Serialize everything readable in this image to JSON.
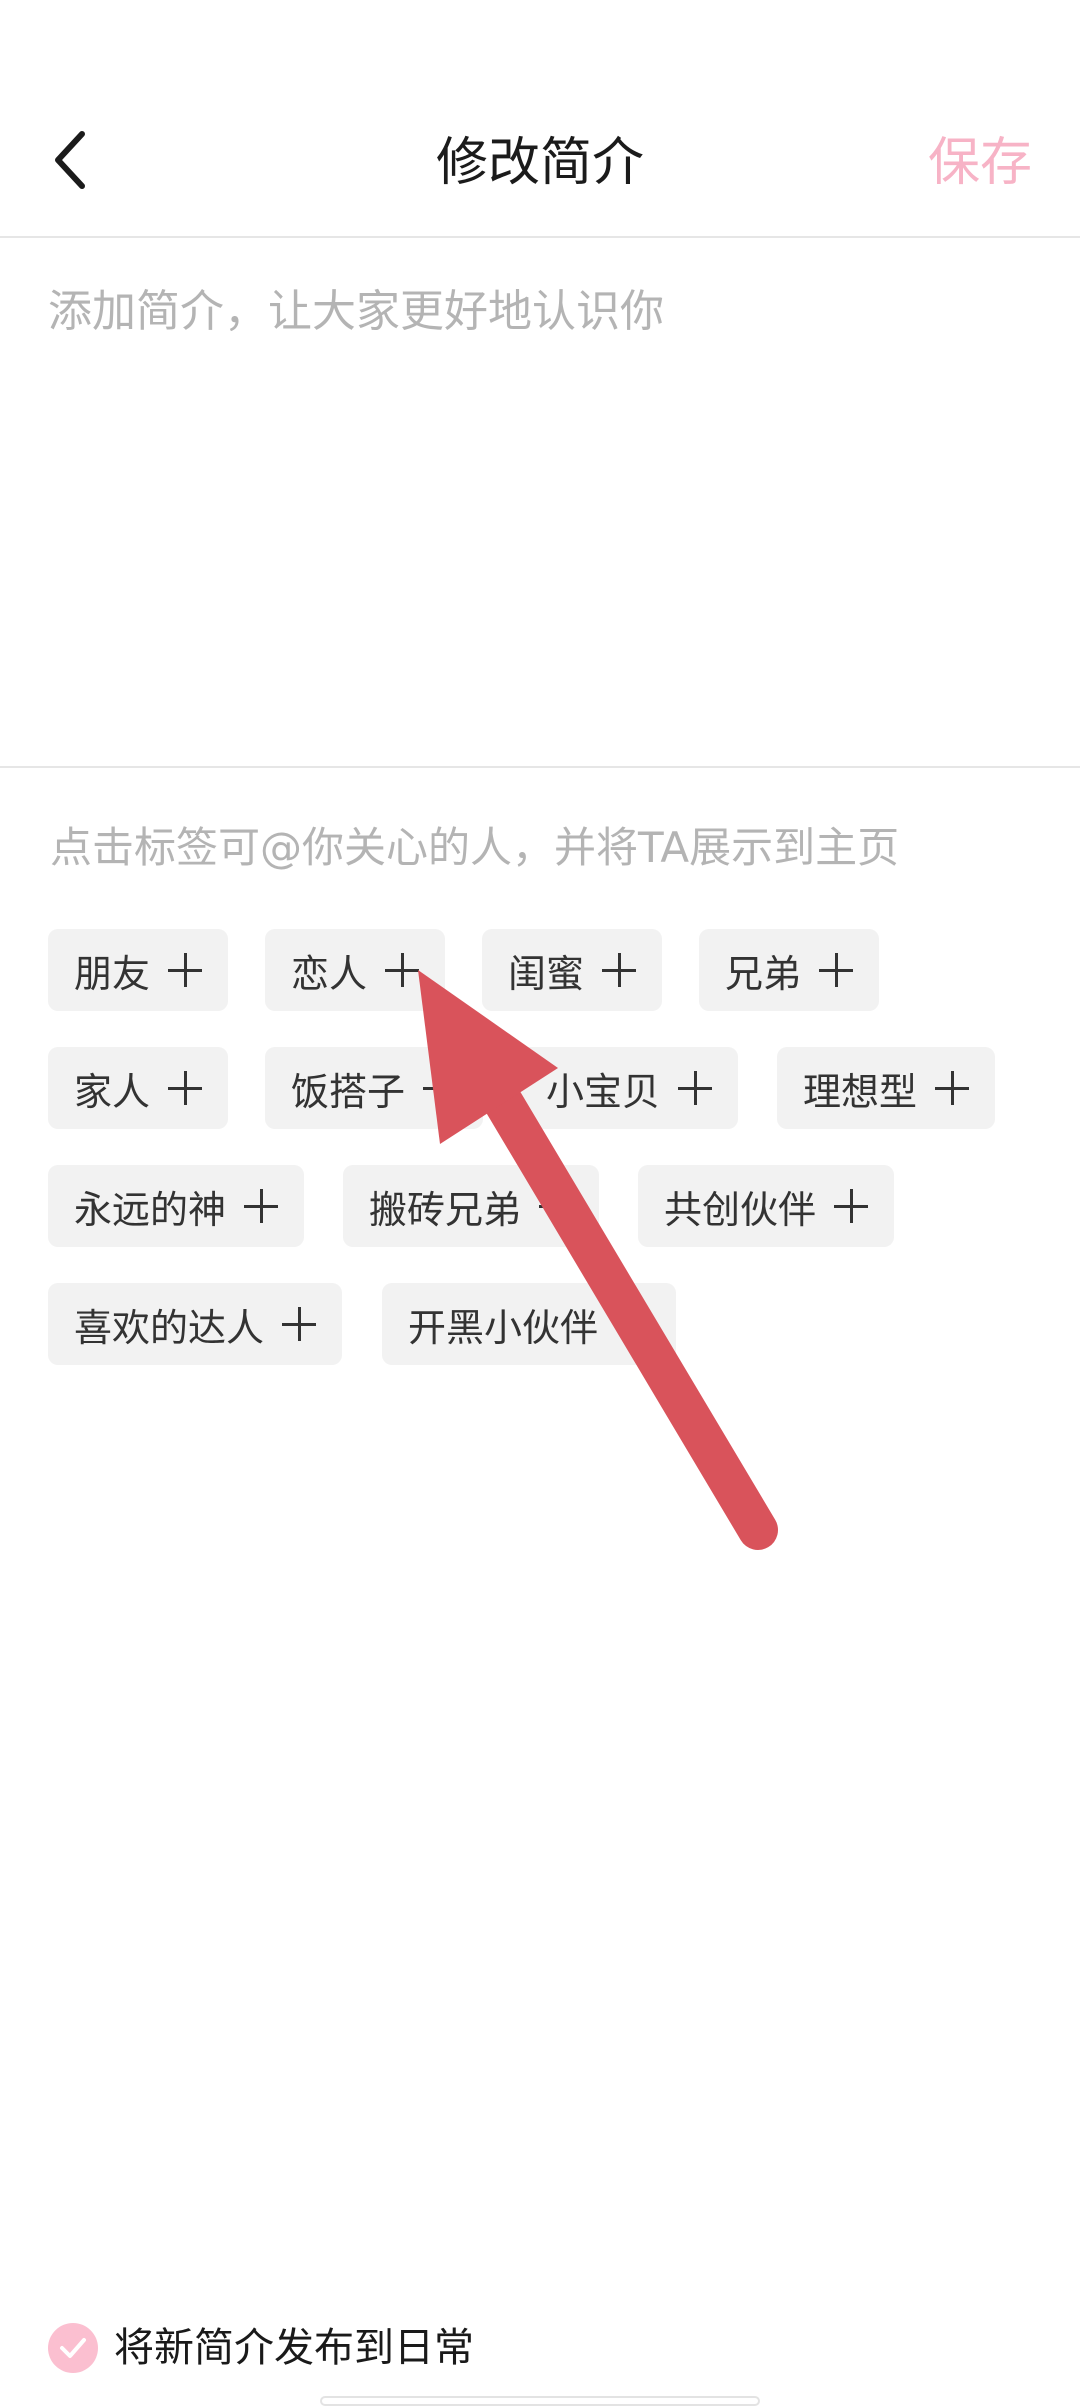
{
  "header": {
    "title": "修改简介",
    "save_label": "保存",
    "back_icon": "chevron-left-icon"
  },
  "bio": {
    "placeholder": "添加简介，让大家更好地认识你",
    "value": ""
  },
  "tags": {
    "hint": "点击标签可@你关心的人，并将TA展示到主页",
    "items": [
      "朋友",
      "恋人",
      "闺蜜",
      "兄弟",
      "家人",
      "饭搭子",
      "小宝贝",
      "理想型",
      "永远的神",
      "搬砖兄弟",
      "共创伙伴",
      "喜欢的达人",
      "开黑小伙伴"
    ],
    "add_icon": "plus-icon"
  },
  "publish": {
    "label": "将新简介发布到日常",
    "checked": true,
    "check_icon": "check-icon"
  },
  "colors": {
    "accent": "#f7b3c6",
    "check_fill": "#fbbfd0",
    "annotation_arrow": "#d9535b",
    "tag_bg": "#f2f2f2",
    "placeholder_text": "#b4b4b4",
    "divider": "#e6e6e6"
  }
}
